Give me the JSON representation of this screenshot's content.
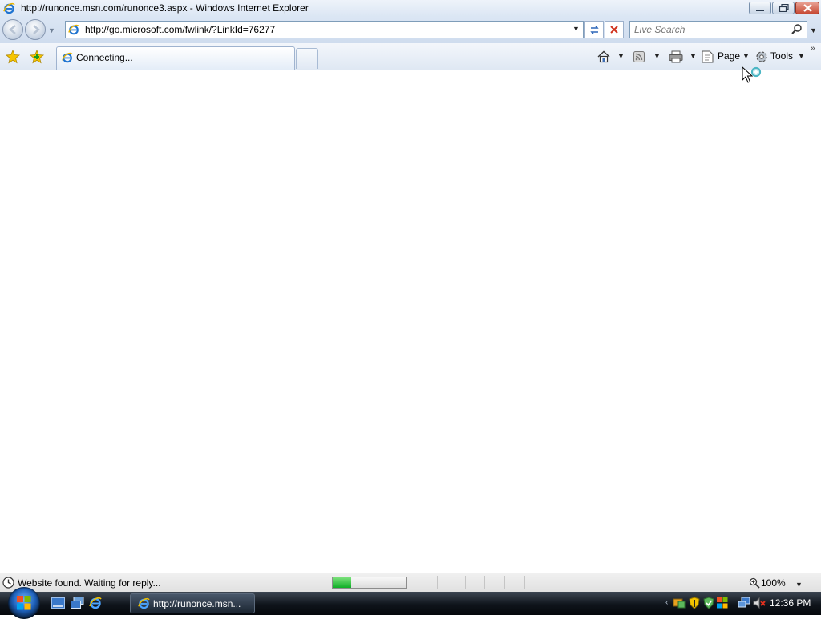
{
  "window": {
    "title": "http://runonce.msn.com/runonce3.aspx - Windows Internet Explorer"
  },
  "address_bar": {
    "url": "http://go.microsoft.com/fwlink/?LinkId=76277"
  },
  "search": {
    "placeholder": "Live Search"
  },
  "tabs": [
    {
      "label": "Connecting...",
      "active": true,
      "icon": "ie-icon"
    }
  ],
  "command_bar": {
    "page_label": "Page",
    "tools_label": "Tools"
  },
  "status_bar": {
    "text": "Website found. Waiting for reply...",
    "progress_fraction": 0.25,
    "zoom": "100%"
  },
  "taskbar": {
    "task_label": "http://runonce.msn...",
    "clock": "12:36 PM"
  },
  "colors": {
    "chrome_top": "#dbe6f4",
    "progress_green": "#0fae26",
    "taskbar": "#0f141b"
  }
}
